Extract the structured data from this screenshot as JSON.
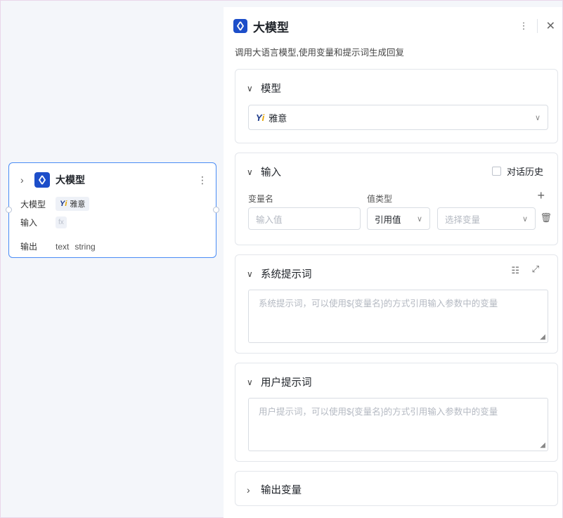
{
  "node": {
    "title": "大模型",
    "rows": [
      {
        "label": "大模型",
        "value": "雅意"
      },
      {
        "label": "输入",
        "value": "fx"
      },
      {
        "label": "输出",
        "value": "text",
        "type": "string"
      }
    ],
    "yi_mark": "Yi"
  },
  "panel": {
    "title": "大模型",
    "description": "调用大语言模型,使用变量和提示词生成回复",
    "model_section": {
      "title": "模型",
      "selected": "雅意",
      "yi_mark": "Yi"
    },
    "input_section": {
      "title": "输入",
      "history_label": "对话历史",
      "col_var": "变量名",
      "col_type": "值类型",
      "var_placeholder": "输入值",
      "type_value": "引用值",
      "ref_placeholder": "选择变量"
    },
    "system_section": {
      "title": "系统提示词",
      "placeholder": "系统提示词，可以使用${变量名}的方式引用输入参数中的变量"
    },
    "user_section": {
      "title": "用户提示词",
      "placeholder": "用户提示词，可以使用${变量名}的方式引用输入参数中的变量"
    },
    "output_section": {
      "title": "输出变量"
    }
  },
  "colors": {
    "accent": "#4a8cf5",
    "logo": "#1d4ec9"
  }
}
